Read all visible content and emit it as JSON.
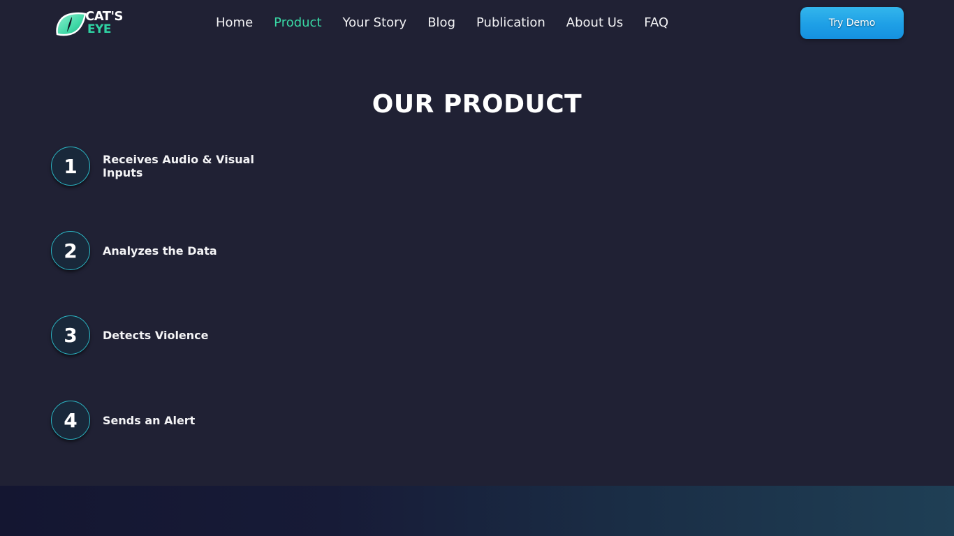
{
  "header": {
    "logo": {
      "top": "CAT'S",
      "bottom": "EYE"
    },
    "nav": [
      {
        "label": "Home"
      },
      {
        "label": "Product",
        "active": true
      },
      {
        "label": "Your Story"
      },
      {
        "label": "Blog"
      },
      {
        "label": "Publication"
      },
      {
        "label": "About Us"
      },
      {
        "label": "FAQ"
      }
    ],
    "demo_button": "Try Demo"
  },
  "main": {
    "title": "OUR PRODUCT",
    "steps": [
      {
        "number": "1",
        "label": "Receives Audio & Visual Inputs"
      },
      {
        "number": "2",
        "label": "Analyzes the Data"
      },
      {
        "number": "3",
        "label": "Detects Violence"
      },
      {
        "number": "4",
        "label": "Sends an Alert"
      }
    ]
  },
  "colors": {
    "background": "#202134",
    "accent": "#39d9a5",
    "button": "#1e9fe6",
    "circle_border": "#2bb7c5"
  }
}
